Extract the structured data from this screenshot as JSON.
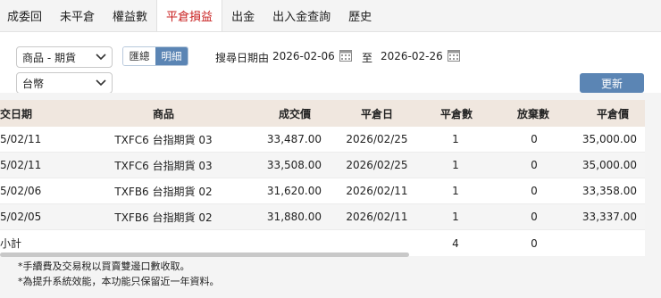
{
  "tabs": [
    {
      "label": "成委回",
      "active": false
    },
    {
      "label": "未平倉",
      "active": false
    },
    {
      "label": "權益數",
      "active": false
    },
    {
      "label": "平倉損益",
      "active": true
    },
    {
      "label": "出金",
      "active": false
    },
    {
      "label": "出入金查詢",
      "active": false
    },
    {
      "label": "歷史",
      "active": false
    }
  ],
  "filters": {
    "product_select": "商品 - 期貨",
    "currency_select": "台幣",
    "toggle": {
      "summary": "匯總",
      "detail": "明細",
      "selected": "detail"
    },
    "range_label": "搜尋日期由",
    "date_from": "2026-02-06",
    "to_label": "至",
    "date_to": "2026-02-26",
    "refresh_label": "更新"
  },
  "table": {
    "headers": [
      "交日期",
      "商品",
      "成交價",
      "平倉日",
      "平倉數",
      "放棄數",
      "平倉價"
    ],
    "rows": [
      [
        "5/02/11",
        "TXFC6 台指期貨 03",
        "33,487.00",
        "2026/02/25",
        "1",
        "0",
        "35,000.00"
      ],
      [
        "5/02/11",
        "TXFC6 台指期貨 03",
        "33,508.00",
        "2026/02/25",
        "1",
        "0",
        "35,000.00"
      ],
      [
        "5/02/06",
        "TXFB6 台指期貨 02",
        "31,620.00",
        "2026/02/11",
        "1",
        "0",
        "33,358.00"
      ],
      [
        "5/02/05",
        "TXFB6 台指期貨 02",
        "31,880.00",
        "2026/02/11",
        "1",
        "0",
        "33,337.00"
      ]
    ],
    "summary": {
      "label": "小計",
      "close_qty": "4",
      "abandon_qty": "0"
    }
  },
  "notes": [
    "*手續費及交易稅以買賣雙邊口數收取。",
    "*為提升系統效能，本功能只保留近一年資料。"
  ],
  "colors": {
    "accent": "#5b85b4",
    "active_tab_text": "#c81e1e",
    "header_bg": "#f0e7df",
    "panel_bg": "#f4f4f4"
  }
}
